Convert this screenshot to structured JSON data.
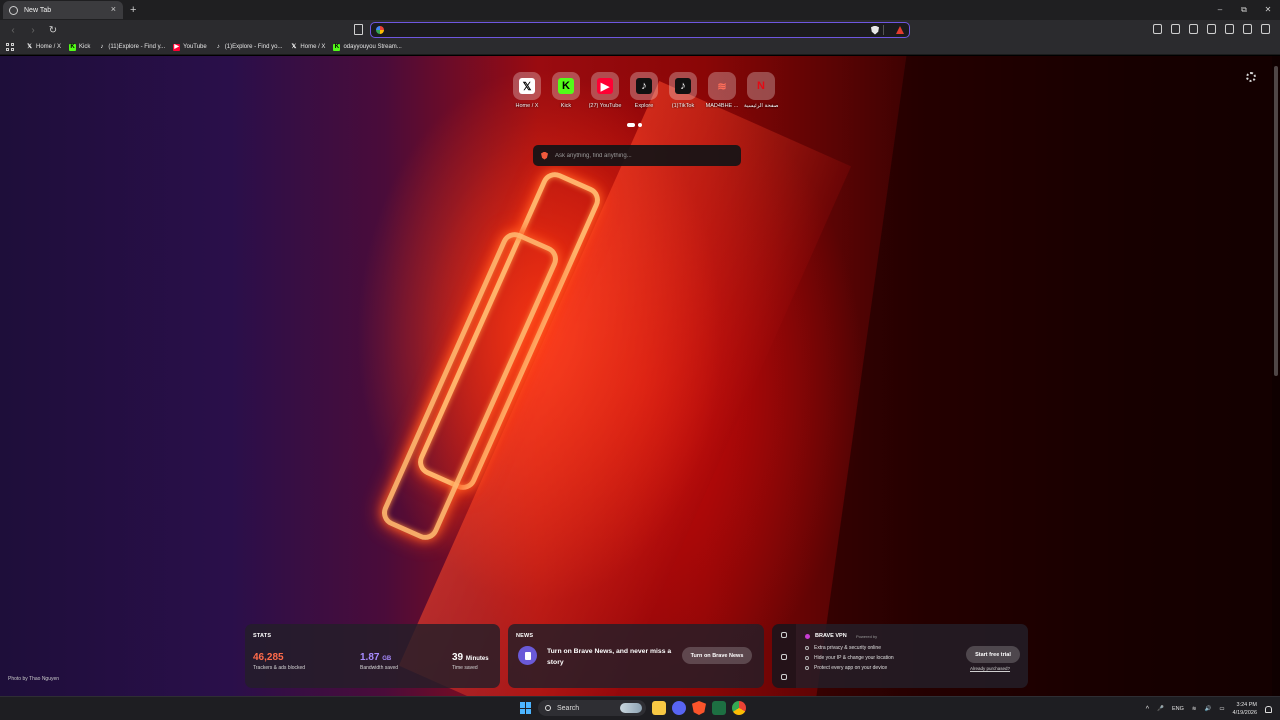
{
  "tab": {
    "title": "New Tab",
    "close": "×",
    "new_tab": "+"
  },
  "window_controls": {
    "minimize": "–",
    "maximize": "⧉",
    "close": "✕"
  },
  "toolbar": {
    "back": "‹",
    "forward": "›",
    "reload": "↻",
    "url_value": "",
    "url_placeholder": ""
  },
  "bookmarks": [
    {
      "label": "Home / X",
      "icon": "x-icon",
      "glyph": "𝕏"
    },
    {
      "label": "Kick",
      "icon": "kick-icon",
      "glyph": "K"
    },
    {
      "label": "(11)Explore - Find y...",
      "icon": "tiktok-icon",
      "glyph": "♪"
    },
    {
      "label": "YouTube",
      "icon": "youtube-icon",
      "glyph": "▶"
    },
    {
      "label": "(1)Explore - Find yo...",
      "icon": "tiktok-icon",
      "glyph": "♪"
    },
    {
      "label": "Home / X",
      "icon": "x-icon",
      "glyph": "𝕏"
    },
    {
      "label": "odayyouyou Stream...",
      "icon": "kick-icon",
      "glyph": "K"
    }
  ],
  "top_sites": [
    {
      "label": "Home / X",
      "glyph": "𝕏"
    },
    {
      "label": "Kick",
      "glyph": "K"
    },
    {
      "label": "(27) YouTube",
      "glyph": "▶"
    },
    {
      "label": "Explore",
      "glyph": "♪"
    },
    {
      "label": "(1)TikTok",
      "glyph": "♪"
    },
    {
      "label": "MAD4BHE ...",
      "glyph": "≋"
    },
    {
      "label": "الصفحة الرئيسية",
      "glyph": "N"
    }
  ],
  "search": {
    "placeholder": "Ask anything, find anything..."
  },
  "photo_credit": "Photo by Thao Nguyen",
  "stats": {
    "title": "STATS",
    "trackers_value": "46,285",
    "trackers_label": "Trackers & ads blocked",
    "bandwidth_value": "1.87",
    "bandwidth_unit": "GB",
    "bandwidth_label": "Bandwidth saved",
    "time_value": "39",
    "time_unit": "Minutes",
    "time_label": "Time saved",
    "colors": {
      "trackers": "#ff6b4a",
      "bandwidth": "#a78bff",
      "time": "#ffffff"
    }
  },
  "news": {
    "title": "NEWS",
    "text": "Turn on Brave News, and never miss a story",
    "button": "Turn on Brave News"
  },
  "vpn": {
    "title": "BRAVE VPN",
    "powered": "Powered by",
    "features": [
      "Extra privacy & security online",
      "Hide your IP & change your location",
      "Protect every app on your device"
    ],
    "button": "Start free trial",
    "purchased": "Already purchased?"
  },
  "taskbar": {
    "search": "Search",
    "language": "ENG",
    "time": "3:24 PM",
    "date": "4/19/2026",
    "tray_up": "^"
  }
}
